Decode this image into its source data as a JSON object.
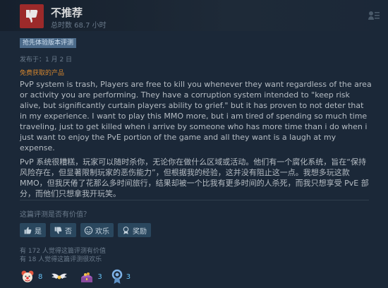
{
  "review": {
    "verdict": "不推荐",
    "hours": "总时数 68.7 小时",
    "early_access": "抢先体验版本评测",
    "posted": "发布于：1 月 2 日",
    "free_product": "免费获取的产品",
    "paragraphs": [
      "PvP system is trash, Players are free to kill you whenever they want regardless of the area or activity you are performing. They have a corruption system intended to \"keep risk alive, but significantly curtain players ability to grief.\" but it has proven to not deter that in my experience. I want to play this MMO more, but i am tired of spending so much time traveling, just to get killed when i arrive by someone who has more time than i do when i just want to enjoy the PvE portion of the game and all they want is a laugh at my expense.",
      "PvP 系统很糟糕，玩家可以随时杀你，无论你在做什么区域或活动。他们有一个腐化系统，旨在“保持风险存在，但显著限制玩家的恶伤能力”，但根据我的经验，这并没有阻止这一点。我想多玩这款 MMO，但我厌倦了花那么多时间旅行，结果却被一个比我有更多时间的人杀死，而我只想享受 PvE 部分，而他们只想拿我开玩笑。"
    ]
  },
  "helpful": {
    "question": "这篇评测是否有价值？",
    "buttons": {
      "yes": "是",
      "no": "否",
      "funny": "欢乐",
      "award": "奖励"
    },
    "helpful_count": "有 172 人觉得这篇评测有价值",
    "funny_count": "有 18 人觉得这篇评测很欢乐"
  },
  "awards": [
    {
      "icon": "clown-award-icon",
      "count": "8"
    },
    {
      "icon": "wings-award-icon",
      "count": ""
    },
    {
      "icon": "treasure-award-icon",
      "count": "3"
    },
    {
      "icon": "medal-award-icon",
      "count": "3"
    }
  ],
  "colors": {
    "background": "#1b2838",
    "thumb_down_box": "#9c2a2a",
    "button": "#2a475e",
    "free_product": "#d3852e",
    "award_count": "#66c0f4"
  }
}
